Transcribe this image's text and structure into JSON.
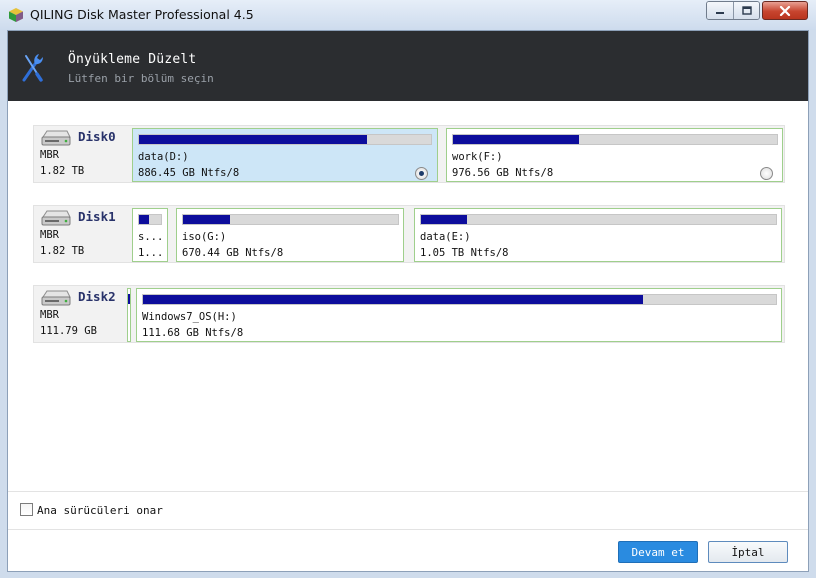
{
  "window": {
    "title": "QILING Disk Master Professional 4.5",
    "icon": "app-cube-icon"
  },
  "header": {
    "title": "Önyükleme Düzelt",
    "subtitle": "Lütfen bir bölüm seçin",
    "icon": "wrench-screwdriver-icon"
  },
  "disks": [
    {
      "name": "Disk0",
      "type": "MBR",
      "size": "1.82 TB",
      "partitions": [
        {
          "label": "data(D:)",
          "detail": "886.45 GB Ntfs/8",
          "used_fraction": 0.78,
          "selected": true
        },
        {
          "label": "work(F:)",
          "detail": "976.56 GB Ntfs/8",
          "used_fraction": 0.39,
          "selected": false
        }
      ]
    },
    {
      "name": "Disk1",
      "type": "MBR",
      "size": "1.82 TB",
      "partitions": [
        {
          "label": "s...",
          "detail": "1...",
          "used_fraction": 0.45
        },
        {
          "label": "iso(G:)",
          "detail": "670.44 GB Ntfs/8",
          "used_fraction": 0.22
        },
        {
          "label": "data(E:)",
          "detail": "1.05 TB Ntfs/8",
          "used_fraction": 0.13
        }
      ]
    },
    {
      "name": "Disk2",
      "type": "MBR",
      "size": "111.79 GB",
      "partitions": [
        {
          "label": "Windows7_OS(H:)",
          "detail": "111.68 GB Ntfs/8",
          "used_fraction": 0.79
        }
      ]
    }
  ],
  "footer": {
    "checkbox_label": "Ana sürücüleri onar",
    "checkbox_checked": false,
    "continue_label": "Devam et",
    "cancel_label": "İptal"
  },
  "colors": {
    "header_bg": "#2b2d30",
    "bar_fill": "#0d0d9c",
    "partition_border": "#9fcf8c",
    "selected_bg": "#cde6f7",
    "primary_button": "#2a8be0"
  }
}
